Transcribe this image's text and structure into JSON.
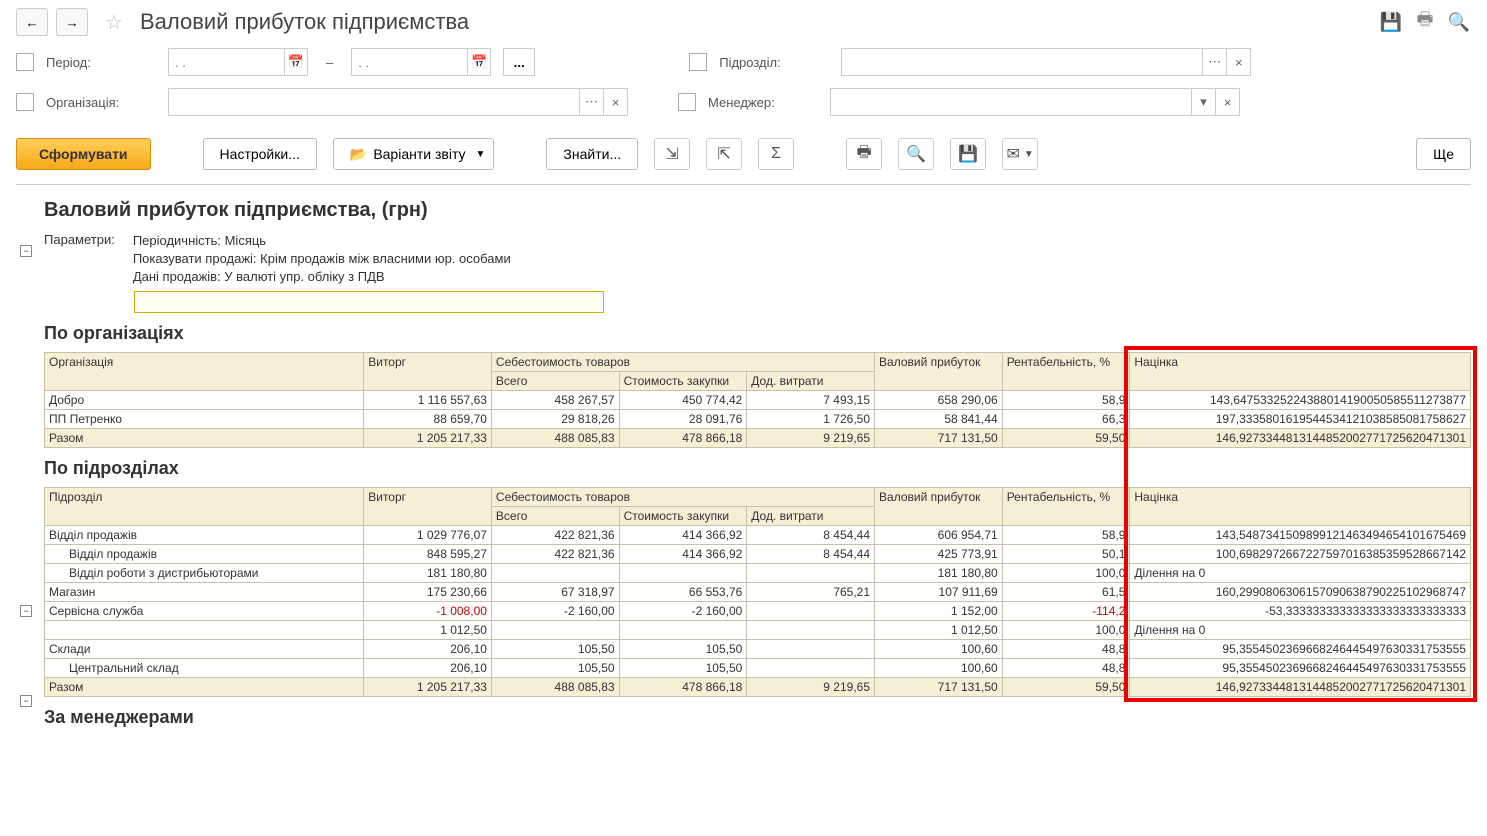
{
  "header": {
    "title": "Валовий прибуток підприємства"
  },
  "filters": {
    "period_label": "Період:",
    "date_placeholder": ". .",
    "dots": "...",
    "organization_label": "Організація:",
    "division_label": "Підрозділ:",
    "manager_label": "Менеджер:"
  },
  "toolbar": {
    "generate": "Сформувати",
    "settings": "Настройки...",
    "variants": "Варіанти звіту",
    "find": "Знайти...",
    "more": "Ще"
  },
  "report": {
    "title": "Валовий прибуток підприємства, (грн)",
    "params_label": "Параметри:",
    "params": [
      "Періодичність: Місяць",
      "Показувати продажі: Крім продажів між власними юр. особами",
      "Дані продажів: У валюті упр. обліку з ПДВ"
    ],
    "sections": {
      "by_org": "По організаціях",
      "by_div": "По підрозділах",
      "by_mgr": "За менеджерами"
    },
    "columns": {
      "organization": "Організація",
      "division": "Підрозділ",
      "revenue": "Виторг",
      "cost_goods": "Себестоимость товаров",
      "total": "Всего",
      "purchase_cost": "Стоимость закупки",
      "add_expenses": "Дод. витрати",
      "gross_profit": "Валовий прибуток",
      "profitability": "Рентабельність, %",
      "markup": "Націнка"
    },
    "div_by_zero": "Ділення на 0",
    "by_org_rows": [
      {
        "name": "Добро",
        "revenue": "1 116 557,63",
        "cost_total": "458 267,57",
        "cost_purchase": "450 774,42",
        "add_exp": "7 493,15",
        "profit": "658 290,06",
        "rent": "58,9",
        "markup": "143,64753325224388014190050585511273877"
      },
      {
        "name": "ПП Петренко",
        "revenue": "88 659,70",
        "cost_total": "29 818,26",
        "cost_purchase": "28 091,76",
        "add_exp": "1 726,50",
        "profit": "58 841,44",
        "rent": "66,3",
        "markup": "197,33358016195445341210385850817586​27"
      }
    ],
    "by_org_total": {
      "name": "Разом",
      "revenue": "1 205 217,33",
      "cost_total": "488 085,83",
      "cost_purchase": "478 866,18",
      "add_exp": "9 219,65",
      "profit": "717 131,50",
      "rent": "59,50",
      "markup": "146,92733448131448520027717256204713​01"
    },
    "by_div_rows": [
      {
        "level": 0,
        "name": "Відділ продажів",
        "revenue": "1 029 776,07",
        "cost_total": "422 821,36",
        "cost_purchase": "414 366,92",
        "add_exp": "8 454,44",
        "profit": "606 954,71",
        "rent": "58,9",
        "markup": "143,54873415098991214634946541016754​69"
      },
      {
        "level": 1,
        "name": "Відділ продажів",
        "revenue": "848 595,27",
        "cost_total": "422 821,36",
        "cost_purchase": "414 366,92",
        "add_exp": "8 454,44",
        "profit": "425 773,91",
        "rent": "50,1",
        "markup": "100,69829726672275970163853595286671​42"
      },
      {
        "level": 1,
        "name": "Відділ роботи з дистрибьюторами",
        "revenue": "181 180,80",
        "cost_total": "",
        "cost_purchase": "",
        "add_exp": "",
        "profit": "181 180,80",
        "rent": "100,0",
        "markup": "",
        "div0": true
      },
      {
        "level": 0,
        "name": "Магазин",
        "revenue": "175 230,66",
        "cost_total": "67 318,97",
        "cost_purchase": "66 553,76",
        "add_exp": "765,21",
        "profit": "107 911,69",
        "rent": "61,5",
        "markup": "160,29908063061570906387902251029687​47"
      },
      {
        "level": 0,
        "name": "Сервісна служба",
        "revenue": "-1 008,00",
        "neg_rev": true,
        "cost_total": "-2 160,00",
        "cost_purchase": "-2 160,00",
        "add_exp": "",
        "profit": "1 152,00",
        "rent": "-114,2",
        "neg_rent": true,
        "markup": "-53,333333333333333333333333333"
      },
      {
        "level": 0,
        "name": "",
        "revenue": "1 012,50",
        "cost_total": "",
        "cost_purchase": "",
        "add_exp": "",
        "profit": "1 012,50",
        "rent": "100,0",
        "markup": "",
        "div0": true
      },
      {
        "level": 0,
        "name": "Склади",
        "revenue": "206,10",
        "cost_total": "105,50",
        "cost_purchase": "105,50",
        "add_exp": "",
        "profit": "100,60",
        "rent": "48,8",
        "markup": "95,3554502369668246445497630331753555"
      },
      {
        "level": 1,
        "name": "Центральний склад",
        "revenue": "206,10",
        "cost_total": "105,50",
        "cost_purchase": "105,50",
        "add_exp": "",
        "profit": "100,60",
        "rent": "48,8",
        "markup": "95,3554502369668246445497630331753555"
      }
    ],
    "by_div_total": {
      "name": "Разом",
      "revenue": "1 205 217,33",
      "cost_total": "488 085,83",
      "cost_purchase": "478 866,18",
      "add_exp": "9 219,65",
      "profit": "717 131,50",
      "rent": "59,50",
      "markup": "146,92733448131448520027717256204713​01"
    }
  }
}
